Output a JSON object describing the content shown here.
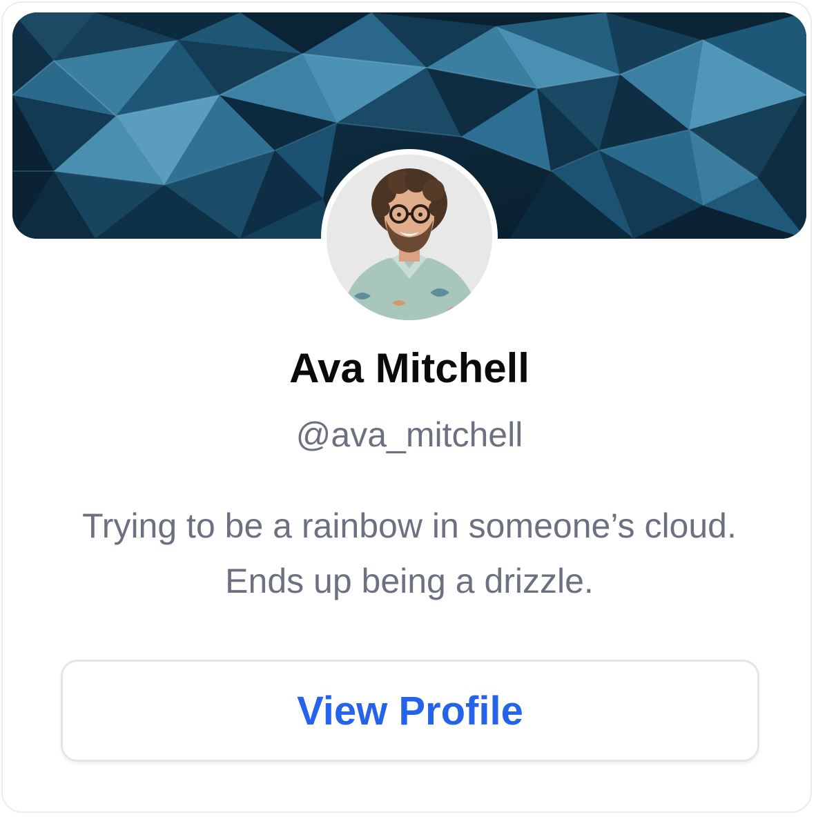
{
  "profile_card": {
    "banner_icon": "abstract-polygon-banner",
    "avatar_icon": "user-portrait-avatar",
    "name": "Ava Mitchell",
    "handle": "@ava_mitchell",
    "bio": "Trying to be a rainbow in someone’s cloud. Ends up being a drizzle.",
    "view_profile_label": "View Profile",
    "colors": {
      "accent": "#2563eb",
      "name_text": "#0a0a0a",
      "muted_text": "#6b7180",
      "border": "#ececef",
      "banner_base": "#0b2233"
    }
  }
}
